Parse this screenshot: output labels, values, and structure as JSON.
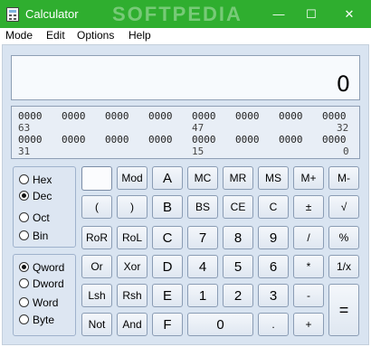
{
  "window": {
    "title": "Calculator",
    "watermark": "SOFTPEDIA",
    "min_glyph": "—",
    "max_glyph": "☐",
    "close_glyph": "✕"
  },
  "menu": [
    "Mode",
    "Edit",
    "Options",
    "Help"
  ],
  "display": {
    "value": "0"
  },
  "binary": {
    "row1_bits": [
      "0000",
      "0000",
      "0000",
      "0000",
      "0000",
      "0000",
      "0000",
      "0000"
    ],
    "row1_positions": [
      "63",
      "47",
      "32"
    ],
    "row2_bits": [
      "0000",
      "0000",
      "0000",
      "0000",
      "0000",
      "0000",
      "0000",
      "0000"
    ],
    "row2_positions": [
      "31",
      "15",
      "0"
    ]
  },
  "number_system": {
    "options": [
      "Hex",
      "Dec",
      "Oct",
      "Bin"
    ],
    "selected": "Dec"
  },
  "word_size": {
    "options": [
      "Qword",
      "Dword",
      "Word",
      "Byte"
    ],
    "selected": "Qword"
  },
  "keys": {
    "mod": "Mod",
    "A": "A",
    "MC": "MC",
    "MR": "MR",
    "MS": "MS",
    "Mplus": "M+",
    "Mminus": "M-",
    "lparen": "(",
    "rparen": ")",
    "B": "B",
    "BS": "BS",
    "CE": "CE",
    "C": "C",
    "plusminus": "±",
    "sqrt": "√",
    "RoR": "RoR",
    "RoL": "RoL",
    "Ckey": "C",
    "7": "7",
    "8": "8",
    "9": "9",
    "div": "/",
    "pct": "%",
    "Or": "Or",
    "Xor": "Xor",
    "D": "D",
    "4": "4",
    "5": "5",
    "6": "6",
    "mul": "*",
    "inv": "1/x",
    "Lsh": "Lsh",
    "Rsh": "Rsh",
    "E": "E",
    "1": "1",
    "2": "2",
    "3": "3",
    "sub": "-",
    "Not": "Not",
    "And": "And",
    "F": "F",
    "0": "0",
    "dot": ".",
    "add": "+",
    "eq": "="
  },
  "colors": {
    "titlebar": "#2fae2f",
    "client_bg": "#d9e4f1"
  }
}
